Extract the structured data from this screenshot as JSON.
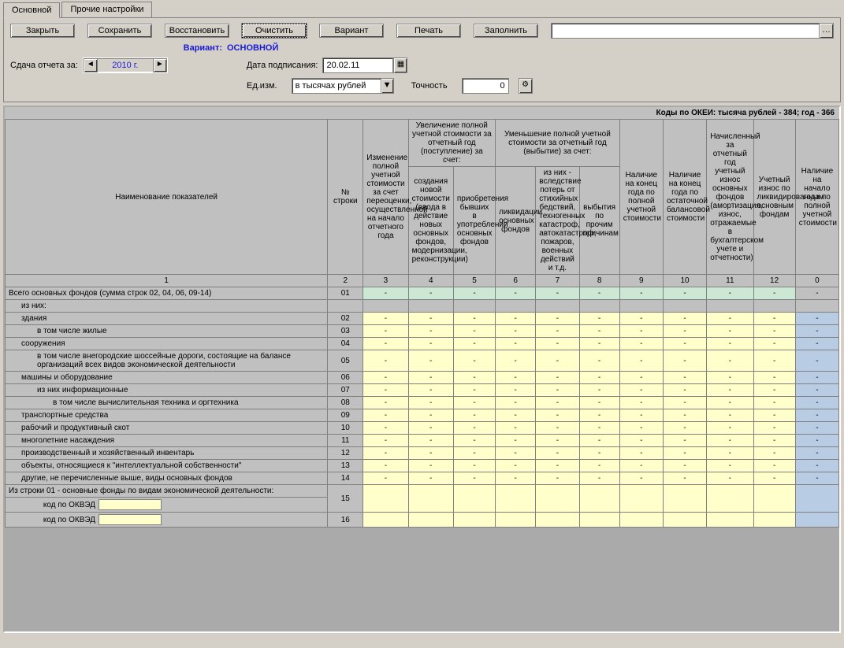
{
  "tabs": {
    "main": "Основной",
    "other": "Прочие настройки"
  },
  "toolbar": {
    "close": "Закрыть",
    "save": "Сохранить",
    "restore": "Восстановить",
    "clear": "Очистить",
    "variant": "Вариант",
    "print": "Печать",
    "fill": "Заполнить"
  },
  "variant": {
    "label": "Вариант:",
    "value": "ОСНОВНОЙ"
  },
  "report_date": {
    "label": "Сдача отчета за:",
    "year": "2010 г."
  },
  "sign_date": {
    "label": "Дата подписания:",
    "value": "20.02.11"
  },
  "unit": {
    "label": "Ед.изм.",
    "value": "в тысячах рублей"
  },
  "precision": {
    "label": "Точность",
    "value": "0"
  },
  "okei": "Коды по ОКЕИ: тысяча рублей - 384; год - 366",
  "headers": {
    "name": "Наименование показателей",
    "row": "№ строки",
    "revalue": "Изменение полной учетной стоимости за счет переоценки, осуществленной на начало отчетного года",
    "increase_group": "Увеличение полной учетной стоимости за отчетный год (поступление) за счет:",
    "inc_create": "создания новой стоимости (ввода в действие новых основных фондов, модернизации, реконструкции)",
    "inc_buy": "приобретения бывших в употреблении основных фондов",
    "decrease_group": "Уменьшение полной учетной стоимости за отчетный год (выбытие) за счет:",
    "dec_liq": "ликвидации основных фондов",
    "dec_disaster": "из них - вследствие потерь от стихийных бедствий, техногенных катастроф, автокатастроф, пожаров, военных действий и т.д.",
    "dec_other": "выбытия по прочим причинам",
    "end_full": "Наличие на конец года по полной учетной стоимости",
    "end_bal": "Наличие на конец года по остаточной балансовой стоимости",
    "depr": "Начисленный за отчетный год учетный износ основных фондов (амортизация, износ, отражаемые в бухгалтерском учете и отчетности)",
    "depr_liq": "Учетный износ по ликвидированным основным фондам",
    "start": "Наличие на начало года по полной учетной стоимости",
    "colnums": [
      "1",
      "2",
      "3",
      "4",
      "5",
      "6",
      "7",
      "8",
      "9",
      "10",
      "11",
      "12",
      "0"
    ]
  },
  "rows": [
    {
      "name": "Всего основных фондов (сумма строк 02, 04, 06, 09-14)",
      "num": "01",
      "type": "total",
      "indent": 0
    },
    {
      "name": "из них:",
      "num": "",
      "type": "header",
      "indent": 1
    },
    {
      "name": "здания",
      "num": "02",
      "type": "data",
      "indent": 1
    },
    {
      "name": "в том числе жилые",
      "num": "03",
      "type": "sub",
      "indent": 2
    },
    {
      "name": "сооружения",
      "num": "04",
      "type": "data",
      "indent": 1
    },
    {
      "name": "в том числе внегородские шоссейные дороги, состоящие на балансе организаций всех видов экономической деятельности",
      "num": "05",
      "type": "sub",
      "indent": 2
    },
    {
      "name": "машины и оборудование",
      "num": "06",
      "type": "data",
      "indent": 1
    },
    {
      "name": "из них информационные",
      "num": "07",
      "type": "sub",
      "indent": 2
    },
    {
      "name": "в том числе вычислительная техника и оргтехника",
      "num": "08",
      "type": "sub",
      "indent": 3
    },
    {
      "name": "транспортные средства",
      "num": "09",
      "type": "data",
      "indent": 1
    },
    {
      "name": "рабочий и продуктивный скот",
      "num": "10",
      "type": "data",
      "indent": 1
    },
    {
      "name": "многолетние насаждения",
      "num": "11",
      "type": "data",
      "indent": 1
    },
    {
      "name": "производственный и хозяйственный инвентарь",
      "num": "12",
      "type": "data",
      "indent": 1
    },
    {
      "name": "объекты, относящиеся к \"интеллектуальной собственности\"",
      "num": "13",
      "type": "data",
      "indent": 1
    },
    {
      "name": "другие, не перечисленные выше, виды основных  фондов",
      "num": "14",
      "type": "data",
      "indent": 1
    }
  ],
  "okved_section": {
    "title": "Из строки 01 - основные фонды по видам экономической деятельности:",
    "label": "код по ОКВЭД",
    "r15": "15",
    "r16": "16"
  }
}
